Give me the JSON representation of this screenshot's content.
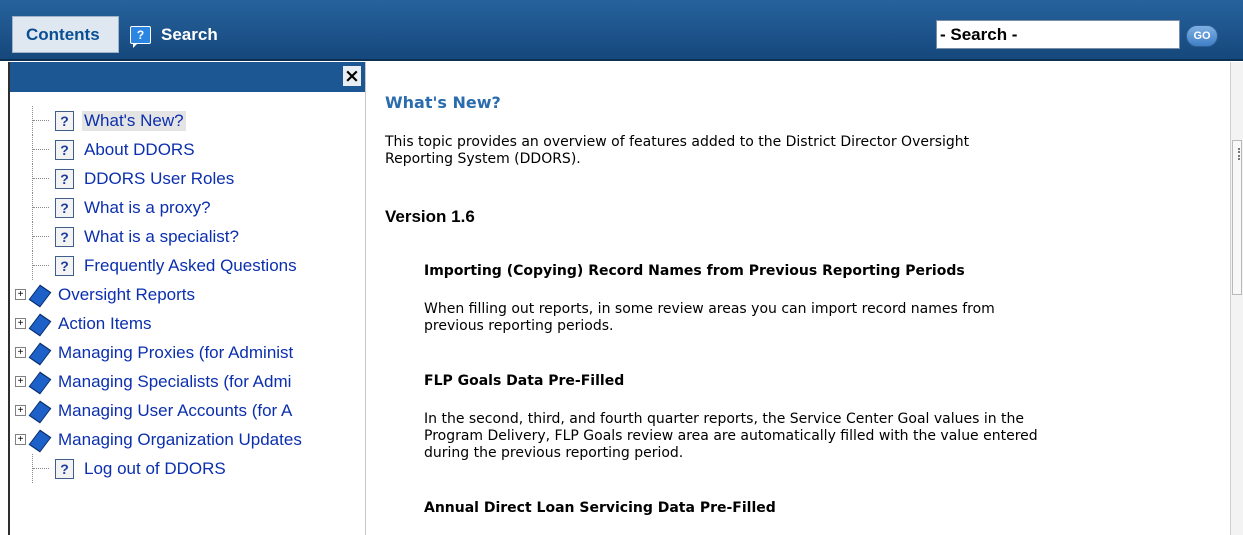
{
  "toolbar": {
    "contents_tab": "Contents",
    "search_tab": "Search",
    "search_icon_glyph": "?",
    "search_value": "- Search -",
    "go_label": "GO"
  },
  "nav": {
    "close_glyph": "×",
    "items": [
      {
        "kind": "topic",
        "label": "What's New?",
        "selected": true
      },
      {
        "kind": "topic",
        "label": "About DDORS"
      },
      {
        "kind": "topic",
        "label": "DDORS User Roles"
      },
      {
        "kind": "topic",
        "label": "What is a proxy?"
      },
      {
        "kind": "topic",
        "label": "What is a specialist?"
      },
      {
        "kind": "topic",
        "label": "Frequently Asked Questions"
      },
      {
        "kind": "book",
        "label": "Oversight Reports"
      },
      {
        "kind": "book",
        "label": "Action Items"
      },
      {
        "kind": "book",
        "label": "Managing Proxies (for Administ"
      },
      {
        "kind": "book",
        "label": "Managing Specialists (for Admi"
      },
      {
        "kind": "book",
        "label": "Managing User Accounts (for A"
      },
      {
        "kind": "book",
        "label": "Managing Organization Updates"
      },
      {
        "kind": "topic",
        "label": "Log out of DDORS"
      }
    ]
  },
  "content": {
    "title": "What's New?",
    "intro_line1": "This topic provides an overview of features added to the District Director Oversight",
    "intro_line2": "Reporting System (DDORS).",
    "version": "Version 1.6",
    "sections": [
      {
        "heading": "Importing (Copying) Record Names from Previous Reporting Periods",
        "line1": "When filling out reports, in some review areas you can import record names from",
        "line2": "previous reporting periods."
      },
      {
        "heading": "FLP Goals Data Pre-Filled",
        "line1": "In the second, third, and fourth quarter reports, the Service Center Goal values in the",
        "line2": "Program Delivery, FLP Goals review area are automatically filled with the value entered",
        "line3": "during the previous reporting period."
      },
      {
        "heading": "Annual Direct Loan Servicing Data Pre-Filled"
      }
    ]
  },
  "colors": {
    "toolbar": "#1d5793",
    "title": "#2a6cad",
    "link": "#0b2fae"
  }
}
